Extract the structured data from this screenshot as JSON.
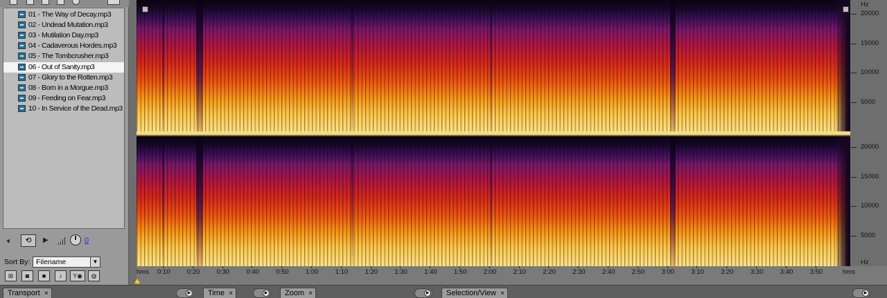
{
  "files": [
    "01 - The Way of Decay.mp3",
    "02 - Undead Mutation.mp3",
    "03 - Mutilation Day.mp3",
    "04 - Cadaverous Hordes.mp3",
    "05 - The Tombcrusher.mp3",
    "06 - Out of Sanity.mp3",
    "07 - Glory to the Rotten.mp3",
    "08 - Born in a Morgue.mp3",
    "09 - Feeding on Fear.mp3",
    "10 - In Service of the Dead.mp3"
  ],
  "selected_file": "06 - Out of Sanity.mp3",
  "player": {
    "volume_value": "0"
  },
  "sort": {
    "label": "Sort By:",
    "value": "Filename"
  },
  "spectral": {
    "freq_unit": "Hz",
    "freq_ticks": [
      "20000",
      "15000",
      "10000",
      "5000"
    ],
    "time_unit": "hms",
    "time_ticks": [
      "0:10",
      "0:20",
      "0:30",
      "0:40",
      "0:50",
      "1:00",
      "1:10",
      "1:20",
      "1:30",
      "1:40",
      "1:50",
      "2:00",
      "2:10",
      "2:20",
      "2:30",
      "2:40",
      "2:50",
      "3:00",
      "3:10",
      "3:20",
      "3:30",
      "3:40",
      "3:50"
    ]
  },
  "tabs": [
    {
      "label": "Transport",
      "close": "×"
    },
    {
      "label": "Time",
      "close": "×"
    },
    {
      "label": "Zoom",
      "close": "×"
    },
    {
      "label": "Selection/View",
      "close": "×"
    }
  ],
  "icons": {
    "file": "mp3-file-icon",
    "speaker": "speaker-icon",
    "loop": "loop-icon",
    "play": "play-icon",
    "volume": "volume-knob-icon"
  },
  "colors": {
    "selection_row": "#f4f4f4",
    "playhead": "#f3d21a",
    "volume_link": "#1b2fd0"
  }
}
